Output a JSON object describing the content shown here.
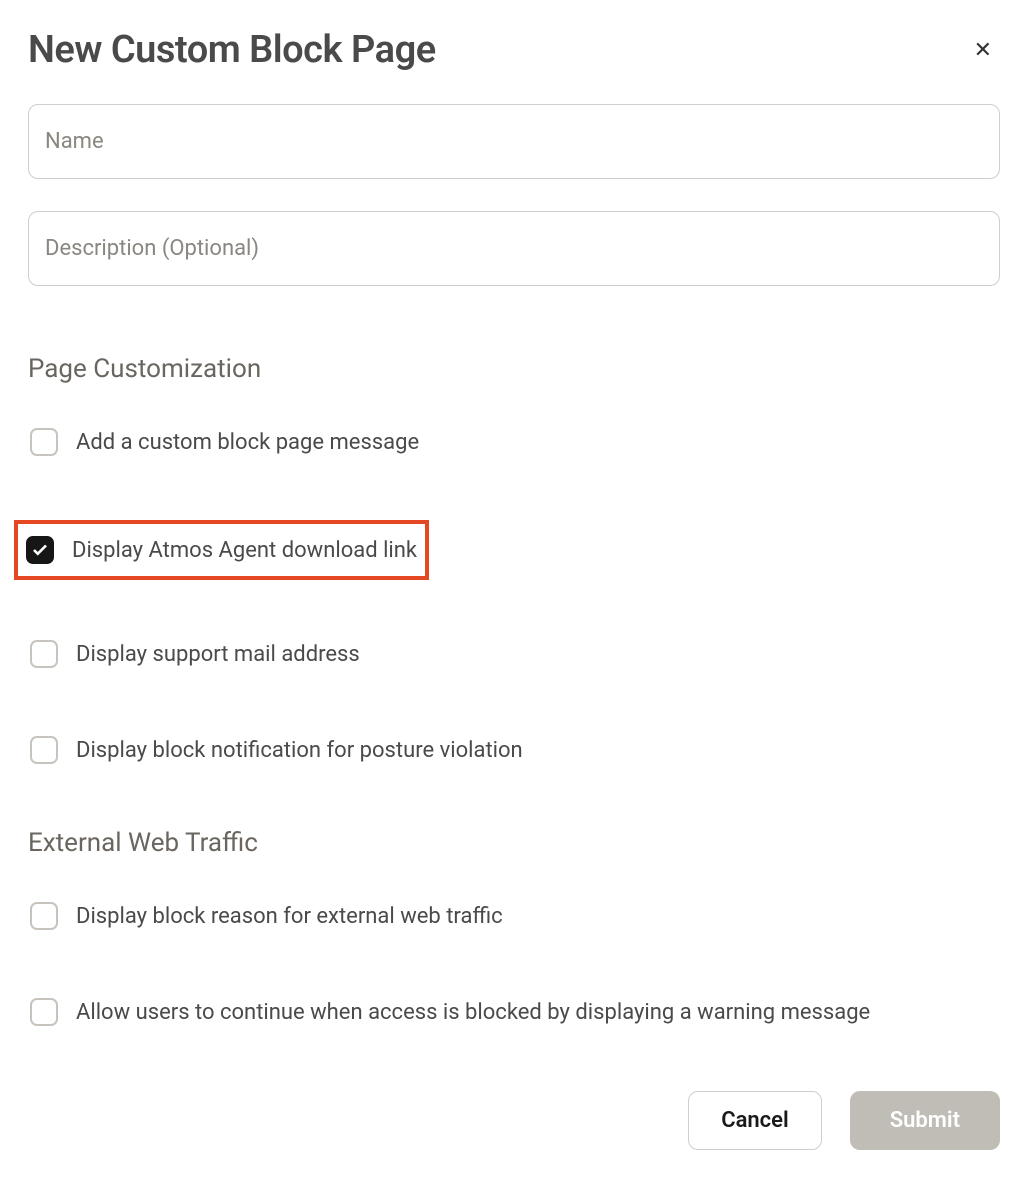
{
  "header": {
    "title": "New Custom Block Page"
  },
  "fields": {
    "name": {
      "placeholder": "Name",
      "value": ""
    },
    "description": {
      "placeholder": "Description (Optional)",
      "value": ""
    }
  },
  "sections": {
    "customization": {
      "heading": "Page Customization",
      "options": [
        {
          "label": "Add a custom block page message",
          "checked": false
        },
        {
          "label": "Display Atmos Agent download link",
          "checked": true,
          "highlighted": true
        },
        {
          "label": "Display support mail address",
          "checked": false
        },
        {
          "label": "Display block notification for posture violation",
          "checked": false
        }
      ]
    },
    "external": {
      "heading": "External Web Traffic",
      "options": [
        {
          "label": "Display block reason for external web traffic",
          "checked": false
        },
        {
          "label": "Allow users to continue when access is blocked by displaying a warning message",
          "checked": false
        }
      ]
    }
  },
  "footer": {
    "cancel": "Cancel",
    "submit": "Submit"
  }
}
